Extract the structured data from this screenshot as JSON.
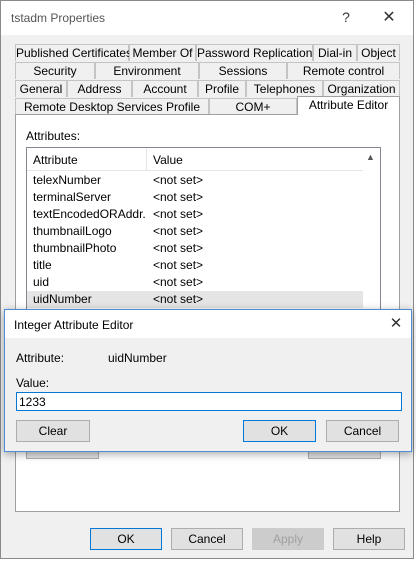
{
  "window": {
    "title": "tstadm Properties",
    "help_glyph": "?",
    "close_glyph": "✕"
  },
  "tabs": {
    "row1": [
      "Published Certificates",
      "Member Of",
      "Password Replication",
      "Dial-in",
      "Object"
    ],
    "row2": [
      "Security",
      "Environment",
      "Sessions",
      "Remote control"
    ],
    "row3": [
      "General",
      "Address",
      "Account",
      "Profile",
      "Telephones",
      "Organization"
    ],
    "row4": [
      "Remote Desktop Services Profile",
      "COM+",
      "Attribute Editor"
    ],
    "selected": "Attribute Editor"
  },
  "attributes": {
    "label": "Attributes:",
    "columns": [
      "Attribute",
      "Value"
    ],
    "rows": [
      {
        "name": "telexNumber",
        "value": "<not set>"
      },
      {
        "name": "terminalServer",
        "value": "<not set>"
      },
      {
        "name": "textEncodedORAddr...",
        "value": "<not set>"
      },
      {
        "name": "thumbnailLogo",
        "value": "<not set>"
      },
      {
        "name": "thumbnailPhoto",
        "value": "<not set>"
      },
      {
        "name": "title",
        "value": "<not set>"
      },
      {
        "name": "uid",
        "value": "<not set>"
      },
      {
        "name": "uidNumber",
        "value": "<not set>"
      }
    ],
    "selected_row": "uidNumber",
    "scroll_up_glyph": "▲"
  },
  "buttons": {
    "ok": "OK",
    "cancel": "Cancel",
    "apply": "Apply",
    "help": "Help"
  },
  "dialog": {
    "title": "Integer Attribute Editor",
    "close_glyph": "✕",
    "attribute_label": "Attribute:",
    "attribute_value": "uidNumber",
    "value_label": "Value:",
    "value": "1233",
    "clear": "Clear",
    "ok": "OK",
    "cancel": "Cancel"
  },
  "colors": {
    "accent": "#0078d7",
    "selected_row": "#e5e5e5"
  }
}
